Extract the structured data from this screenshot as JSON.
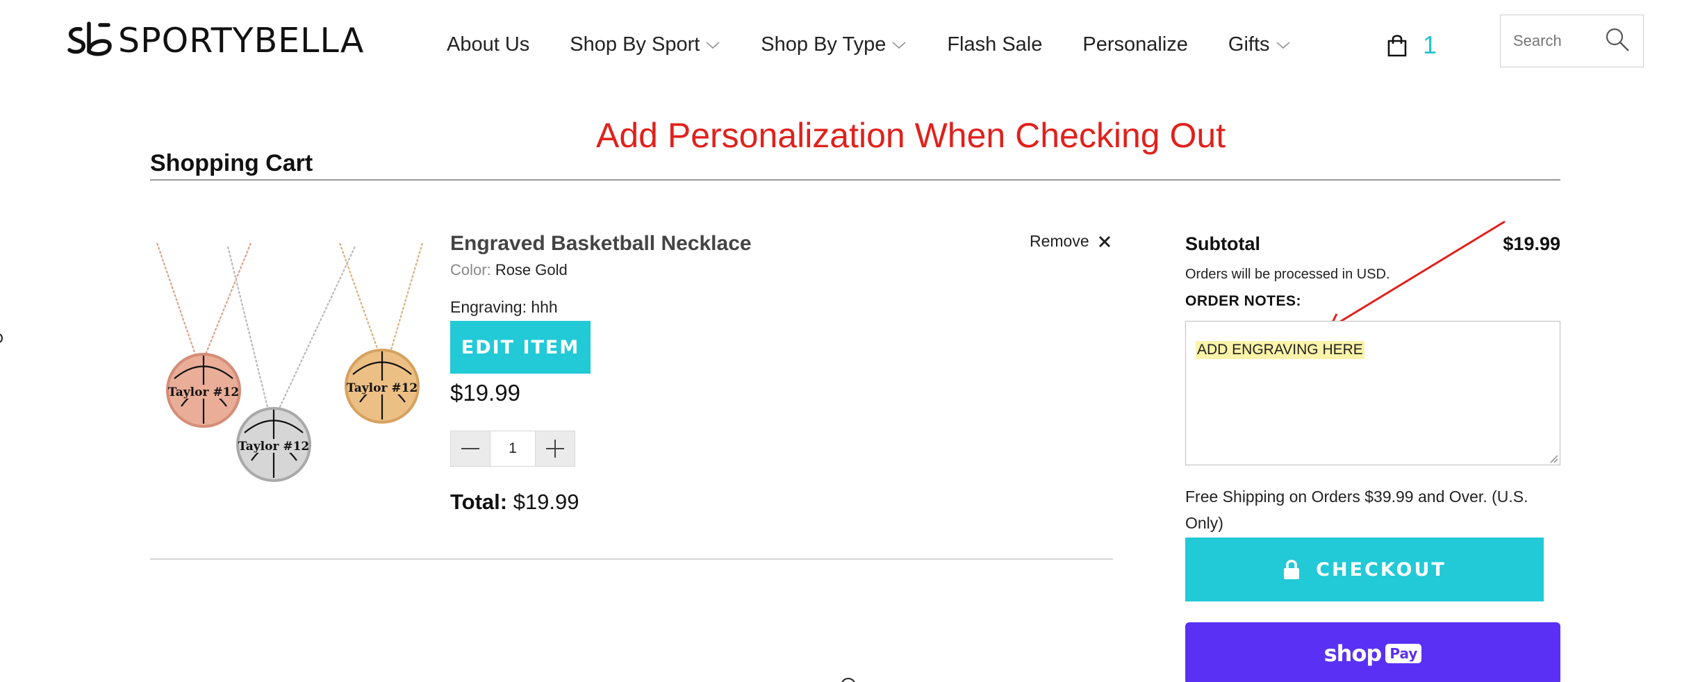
{
  "header": {
    "logo_text": "SPORTYBELLA",
    "nav": {
      "about": "About Us",
      "shop_by_sport": "Shop By Sport",
      "shop_by_type": "Shop By Type",
      "flash_sale": "Flash Sale",
      "personalize": "Personalize",
      "gifts": "Gifts"
    },
    "cart_count": "1",
    "search_placeholder": "Search"
  },
  "annotation": {
    "text": "Add Personalization When Checking Out",
    "color": "#e0211c"
  },
  "cart": {
    "title": "Shopping Cart",
    "item": {
      "name": "Engraved Basketball Necklace",
      "color_label": "Color:",
      "color_value": "Rose Gold",
      "engraving": "Engraving: hhh",
      "edit_label": "EDIT ITEM",
      "price": "$19.99",
      "quantity": "1",
      "total_label": "Total:",
      "total_value": "$19.99",
      "remove_label": "Remove",
      "pendant_text": "Taylor #12"
    }
  },
  "summary": {
    "subtotal_label": "Subtotal",
    "subtotal_value": "$19.99",
    "currency_note": "Orders will be processed in USD.",
    "order_notes_label": "ORDER NOTES:",
    "order_notes_value": "ADD ENGRAVING HERE",
    "shipping_note": "Free Shipping on Orders $39.99 and Over. (U.S. Only)",
    "checkout_label": "CHECKOUT",
    "shoppay_word": "shop",
    "shoppay_badge": "Pay"
  },
  "colors": {
    "accent": "#22c9d6",
    "shoppay": "#5a31f4",
    "highlight": "#fbf3a9"
  }
}
